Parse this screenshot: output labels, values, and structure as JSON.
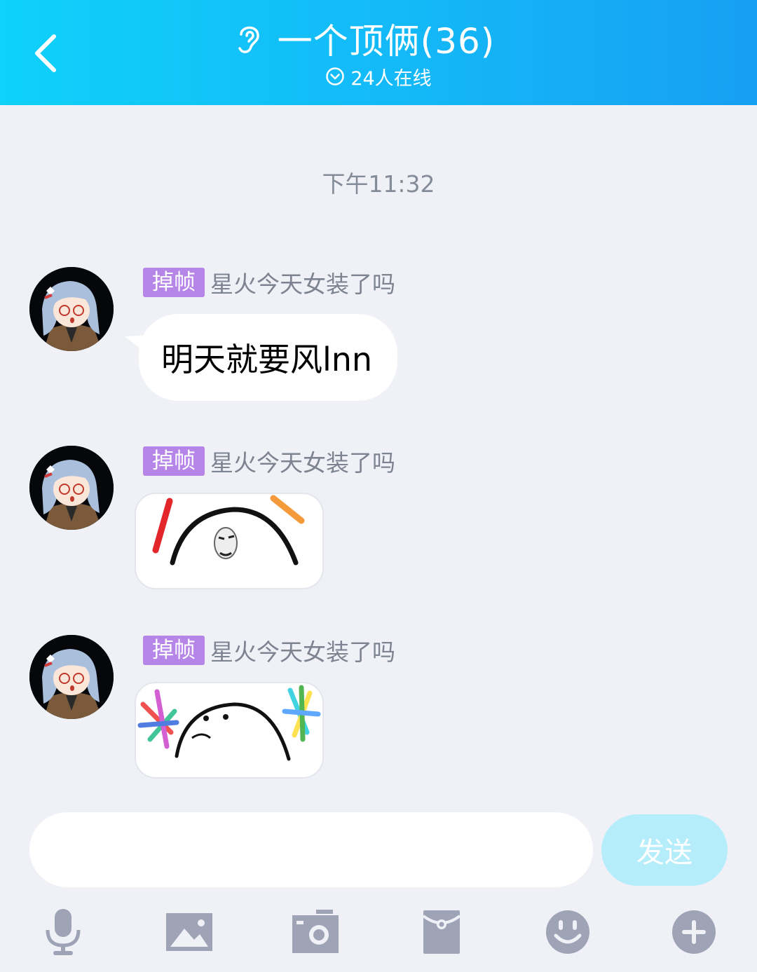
{
  "header": {
    "title": "一个顶俩(36)",
    "subtitle": "24人在线"
  },
  "chat": {
    "timestamp": "下午11:32",
    "messages": [
      {
        "badge": "掉帧",
        "sender": "星火今天女装了吗",
        "type": "text",
        "text": "明天就要风lnn"
      },
      {
        "badge": "掉帧",
        "sender": "星火今天女装了吗",
        "type": "sticker",
        "sticker": "glowstick-meme-face"
      },
      {
        "badge": "掉帧",
        "sender": "星火今天女装了吗",
        "type": "sticker",
        "sticker": "rainbow-glowstick-blob"
      }
    ]
  },
  "input": {
    "value": "",
    "placeholder": "",
    "send_label": "发送"
  },
  "toolbar": {
    "items": [
      "microphone-icon",
      "image-icon",
      "camera-icon",
      "red-packet-icon",
      "emoji-icon",
      "plus-icon"
    ]
  },
  "colors": {
    "header_gradient_start": "#0fd1fb",
    "header_gradient_end": "#179ff3",
    "badge": "#b685e8",
    "send_button": "#b5edfb",
    "background": "#eff1f7",
    "toolbar_icon": "#9ea3b6"
  }
}
